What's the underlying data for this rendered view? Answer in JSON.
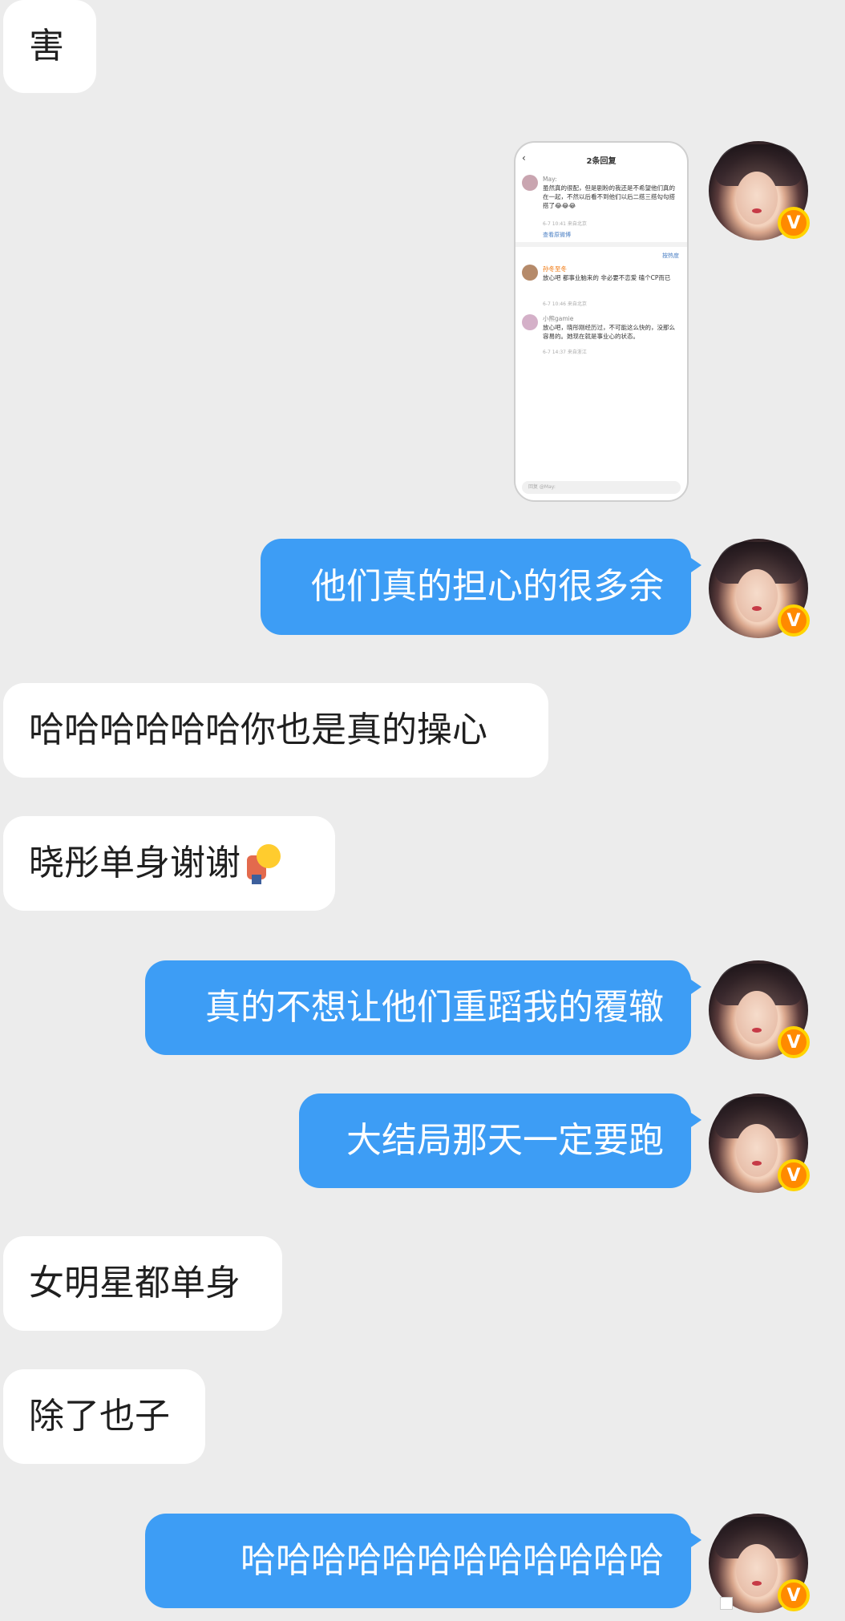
{
  "messages": [
    {
      "side": "left",
      "text": "害"
    },
    {
      "side": "right",
      "type": "image"
    },
    {
      "side": "right",
      "text": "他们真的担心的很多余"
    },
    {
      "side": "left",
      "text": "哈哈哈哈哈哈你也是真的操心"
    },
    {
      "side": "left",
      "text": "晓彤单身谢谢"
    },
    {
      "side": "right",
      "text": "真的不想让他们重蹈我的覆辙"
    },
    {
      "side": "right",
      "text": "大结局那天一定要跑"
    },
    {
      "side": "left",
      "text": "女明星都单身"
    },
    {
      "side": "left",
      "text": "除了也子"
    },
    {
      "side": "right",
      "text": "哈哈哈哈哈哈哈哈哈哈哈哈"
    }
  ],
  "avatar": {
    "badge": "V"
  },
  "screenshot": {
    "title": "2条回复",
    "main_name": "May:",
    "main_comment": "虽然真的很配，但是剧粉的我还是不希望他们真的在一起，不然以后看不到他们以后二搭三搭勾勾搭搭了😂😂😂",
    "main_meta": "6-7 10:41 来自北京",
    "view_link": "查看原微博",
    "sort_label": "按热度",
    "reply1_name": "孙冬至冬",
    "reply1_text": "放心吧 都事业脑来的 非必要不恋爱 磕个CP而已",
    "reply1_meta": "6-7 10:46 来自北京",
    "reply2_name": "小熊gamie",
    "reply2_text": "放心吧，晓彤刚经历过，不可能这么快的，没那么容易的。她现在就是事业心的状态。",
    "reply2_meta": "6-7 14:37 来自浙江",
    "input_placeholder": "回复 @May:"
  }
}
